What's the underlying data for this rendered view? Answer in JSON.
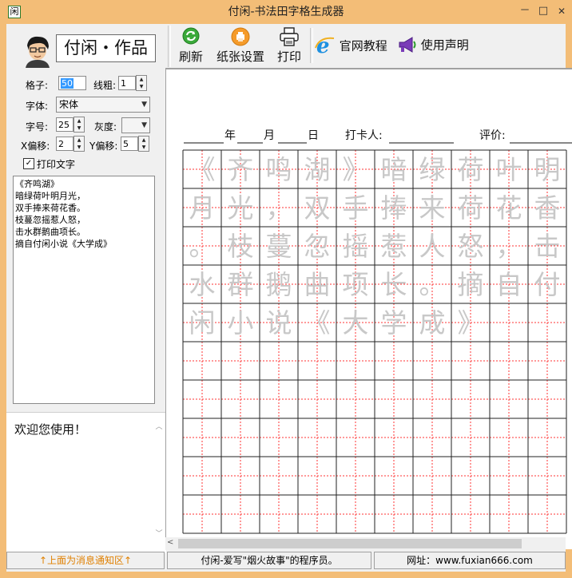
{
  "window": {
    "title": "付闲-书法田字格生成器",
    "app_icon_glyph": "闲",
    "minimize": "－",
    "maximize": "□",
    "close": "✕"
  },
  "brand": {
    "text": "付闲・作品",
    "avatar_icon": "cartoon-avatar-icon"
  },
  "settings": {
    "grid_label": "格子:",
    "grid_value": "50",
    "line_width_label": "线粗:",
    "line_width_value": "1",
    "font_label": "字体:",
    "font_value": "宋体",
    "size_label": "字号:",
    "size_value": "25",
    "gray_label": "灰度:",
    "gray_value": "",
    "xoffset_label": "X偏移:",
    "xoffset_value": "2",
    "yoffset_label": "Y偏移:",
    "yoffset_value": "5",
    "print_text_label": "打印文字",
    "print_text_checked": true
  },
  "text_input": "《齐鸣湖》\n暗绿荷叶明月光，\n双手捧来荷花香。\n枝蔓忽摇惹人怒，\n击水群鹅曲项长。\n摘自付闲小说《大学成》",
  "message_area": {
    "text": "欢迎您使用！"
  },
  "toolbar": {
    "refresh": "刷新",
    "page_setup": "纸张设置",
    "print": "打印",
    "website": "官网教程",
    "statement": "使用声明"
  },
  "paper": {
    "header_year": "年",
    "header_month": "月",
    "header_day": "日",
    "header_checkin": "打卡人:",
    "header_eval": "评价:",
    "characters": "《齐鸣湖》暗绿荷叶明月光，双手捧来荷花香。枝蔓忽摇惹人怒，击水群鹅曲项长。摘自付闲小说《大学成》",
    "grid_color": "#ff3333",
    "char_color": "#c8c8c8"
  },
  "statusbar": {
    "left": "↑上面为消息通知区↑",
    "middle": "付闲-爱写\"烟火故事\"的程序员。",
    "right": "网址：www.fuxian666.com"
  }
}
